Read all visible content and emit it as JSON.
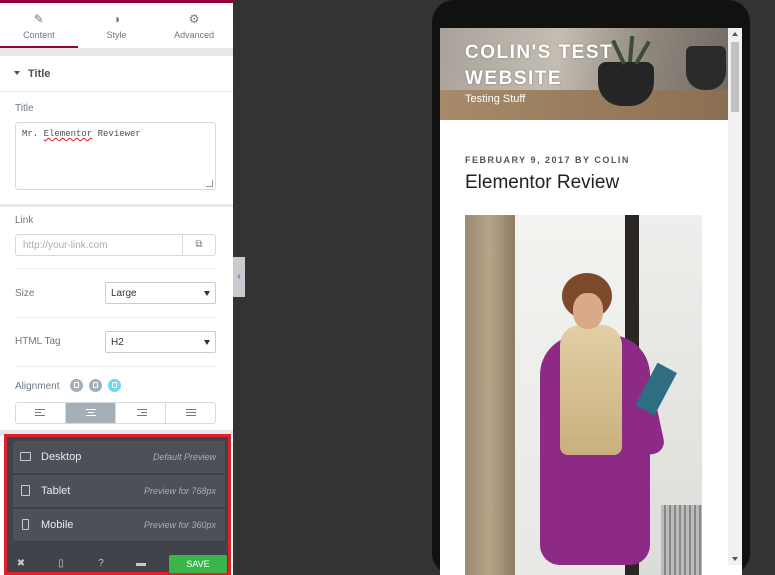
{
  "panel": {
    "tabs": [
      {
        "label": "Content",
        "icon": "pencil-icon"
      },
      {
        "label": "Style",
        "icon": "contrast-icon"
      },
      {
        "label": "Advanced",
        "icon": "gear-icon"
      }
    ],
    "section_title": "Title",
    "title_label": "Title",
    "title_value_pre": "Mr. ",
    "title_value_misspelled": "Elementor",
    "title_value_post": " Reviewer",
    "link_label": "Link",
    "link_placeholder": "http://your-link.com",
    "size_label": "Size",
    "size_value": "Large",
    "html_tag_label": "HTML Tag",
    "html_tag_value": "H2",
    "alignment_label": "Alignment"
  },
  "responsive_menu": {
    "items": [
      {
        "name": "Desktop",
        "hint": "Default Preview"
      },
      {
        "name": "Tablet",
        "hint": "Preview for 768px"
      },
      {
        "name": "Mobile",
        "hint": "Preview for 360px"
      }
    ],
    "save_label": "SAVE"
  },
  "preview": {
    "site_title": "COLIN'S TEST WEBSITE",
    "tagline": "Testing Stuff",
    "post_meta": "FEBRUARY 9, 2017 BY COLIN",
    "post_title": "Elementor Review"
  },
  "colors": {
    "accent": "#93003c",
    "save_green": "#39b54a",
    "highlight_red": "#e0202a",
    "active_device": "#71d7f7"
  }
}
